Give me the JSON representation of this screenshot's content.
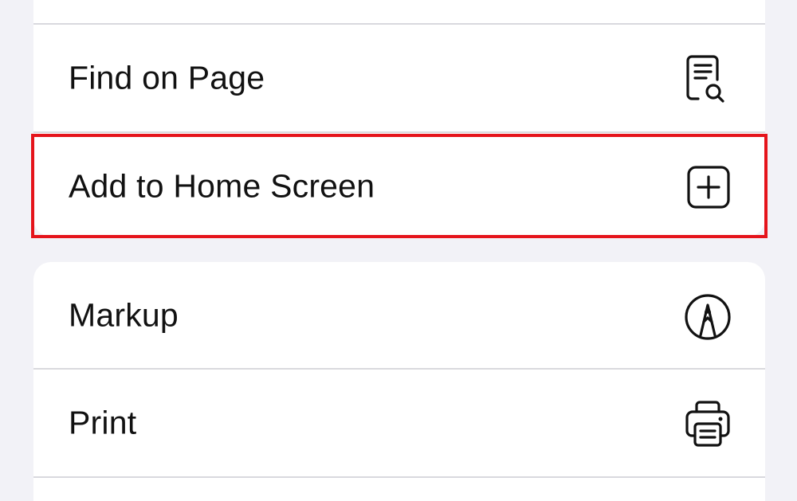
{
  "menu": {
    "group_top": {
      "items": [
        {
          "label": "Find on Page",
          "icon": "find-on-page-icon"
        },
        {
          "label": "Add to Home Screen",
          "icon": "add-square-icon",
          "highlighted": true
        }
      ]
    },
    "group_bottom": {
      "items": [
        {
          "label": "Markup",
          "icon": "markup-pen-icon"
        },
        {
          "label": "Print",
          "icon": "printer-icon"
        }
      ]
    }
  },
  "colors": {
    "background": "#f2f2f7",
    "row": "#ffffff",
    "separator": "#d9d9de",
    "text": "#111111",
    "highlight": "#e5141b"
  }
}
